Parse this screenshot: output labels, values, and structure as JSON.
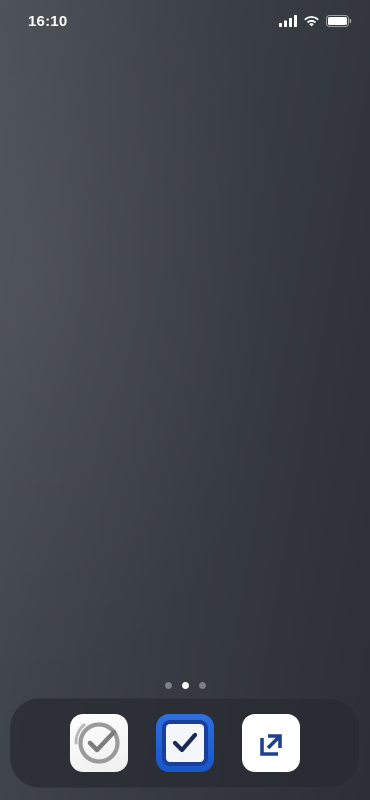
{
  "status_bar": {
    "time": "16:10",
    "icons": [
      "cellular-signal-icon",
      "wifi-icon",
      "battery-icon"
    ]
  },
  "home": {
    "page_count": 3,
    "active_page": 2
  },
  "dock": {
    "apps": [
      {
        "icon": "checkmark-circle-app-icon",
        "accent": "#8a8a8a"
      },
      {
        "icon": "checkbox-app-icon",
        "accent": "#1f63d8"
      },
      {
        "icon": "expand-square-app-icon",
        "accent": "#1f3f8f"
      }
    ]
  },
  "colors": {
    "wallpaper": "#3a3e45",
    "dock": "#2a2d33"
  }
}
